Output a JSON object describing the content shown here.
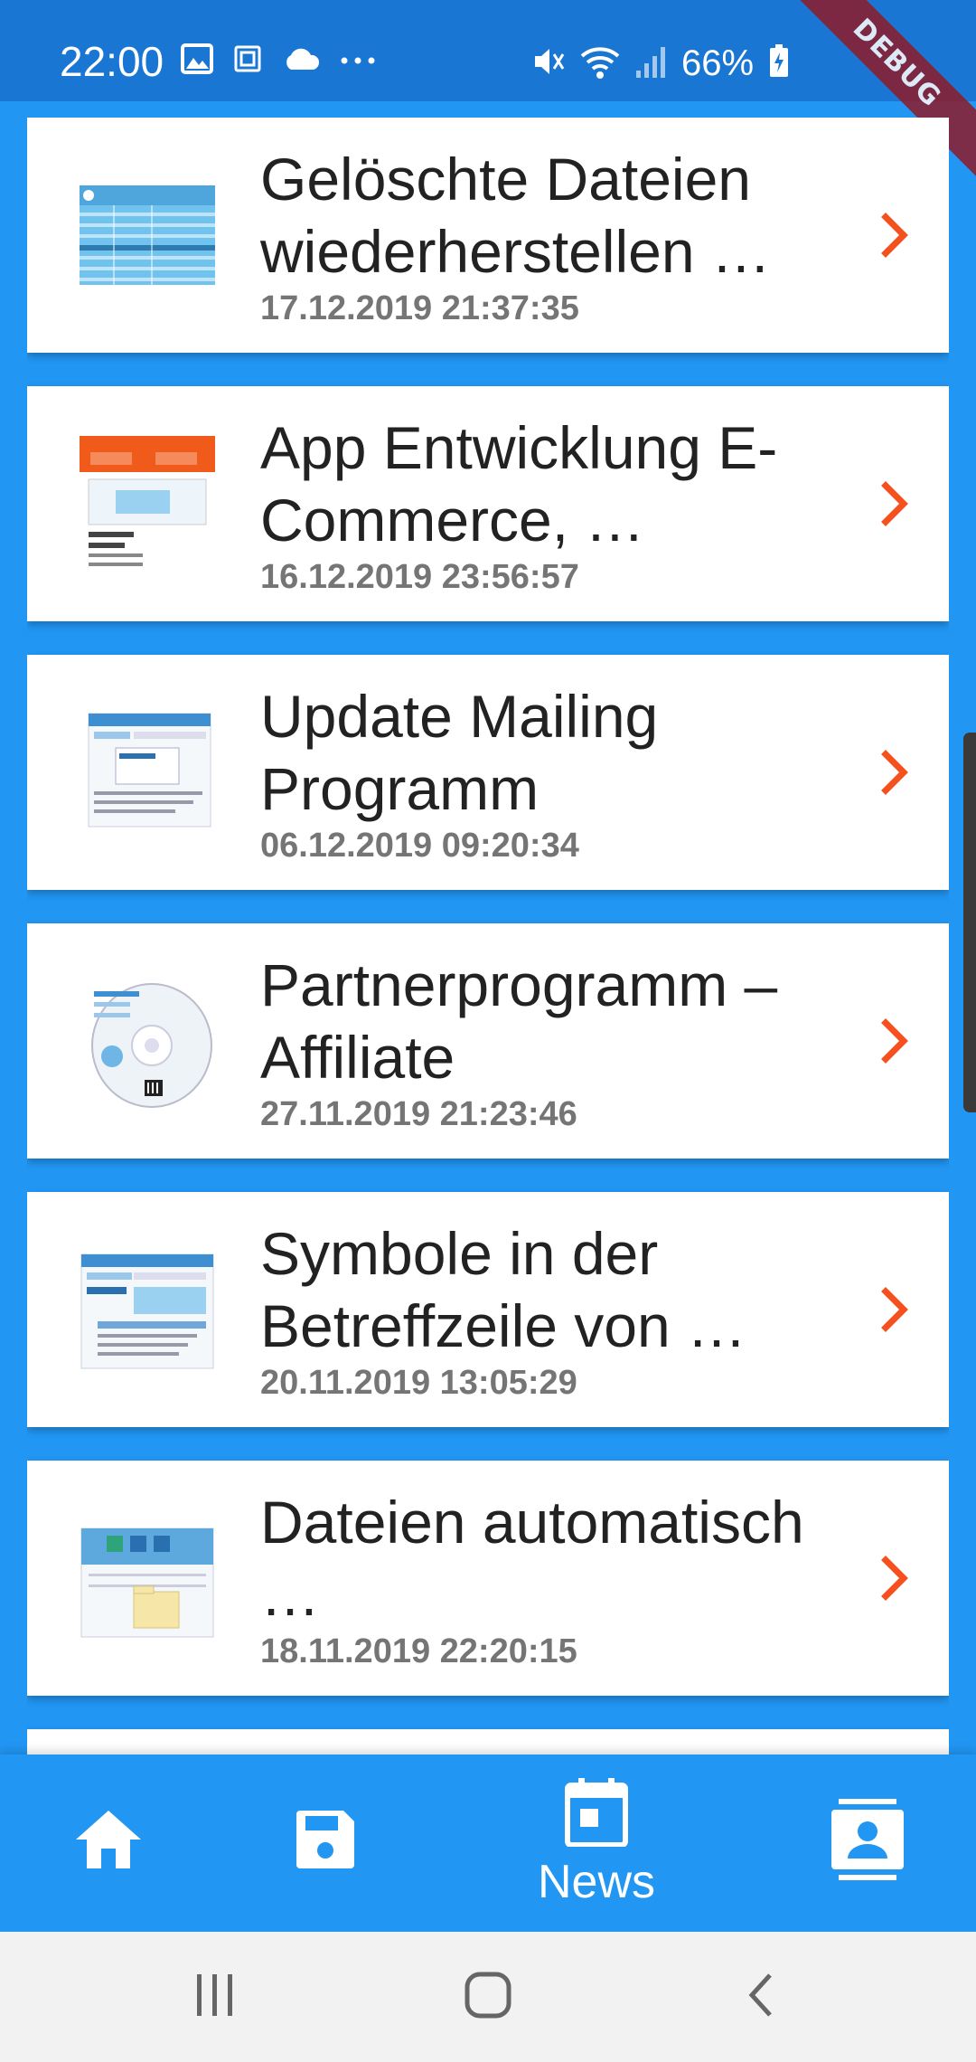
{
  "status_bar": {
    "time": "22:00",
    "battery_percent": "66%",
    "left_icons": [
      "image-icon",
      "sim-card-icon",
      "cloud-icon",
      "more-dots-icon"
    ],
    "right_icons": [
      "mute-icon",
      "wifi-icon",
      "signal-icon",
      "battery-charging-icon"
    ],
    "debug_label": "DEBUG"
  },
  "colors": {
    "background": "#2196F3",
    "status_bar": "#1976D2",
    "accent": "#F4511E",
    "card": "#FFFFFF",
    "title_text": "#222222",
    "date_text": "#757575"
  },
  "news": {
    "items": [
      {
        "title": "Gelöschte Dateien wiederherstellen …",
        "date": "17.12.2019 21:37:35",
        "thumb": "table-screenshot"
      },
      {
        "title": "App Entwicklung E-Commerce, …",
        "date": "16.12.2019 23:56:57",
        "thumb": "newsletter-box"
      },
      {
        "title": "Update Mailing Programm",
        "date": "06.12.2019 09:20:34",
        "thumb": "mailing-screenshot"
      },
      {
        "title": "Partnerprogramm – Affiliate",
        "date": "27.11.2019 21:23:46",
        "thumb": "cd-disc"
      },
      {
        "title": "Symbole in der Betreffzeile von …",
        "date": "20.11.2019 13:05:29",
        "thumb": "mail-screenshot"
      },
      {
        "title": "Dateien automatisch …",
        "date": "18.11.2019 22:20:15",
        "thumb": "folder-screenshot"
      }
    ]
  },
  "bottom_nav": {
    "items": [
      {
        "icon": "home-icon",
        "label": ""
      },
      {
        "icon": "save-icon",
        "label": ""
      },
      {
        "icon": "calendar-icon",
        "label": "News",
        "active": true
      },
      {
        "icon": "contact-icon",
        "label": ""
      }
    ]
  },
  "system_nav": {
    "buttons": [
      "recents-icon",
      "home-circle-icon",
      "back-icon"
    ]
  }
}
